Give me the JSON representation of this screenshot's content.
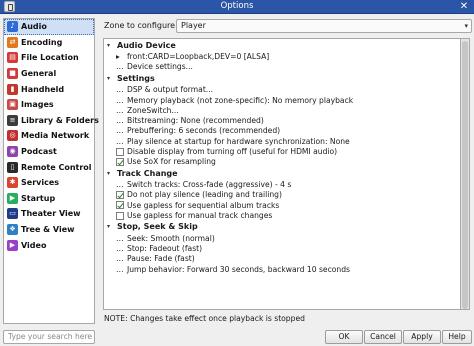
{
  "window": {
    "title": "Options",
    "close_glyph": "✕"
  },
  "sidebar": {
    "items": [
      {
        "label": "Audio",
        "icon": "audio-icon",
        "color": "#2e6bd6",
        "glyph": "♪",
        "selected": true
      },
      {
        "label": "Encoding",
        "icon": "encoding-icon",
        "color": "#e07a1f",
        "glyph": "⇄"
      },
      {
        "label": "File Location",
        "icon": "file-location-icon",
        "color": "#d43a3a",
        "glyph": "▤"
      },
      {
        "label": "General",
        "icon": "general-icon",
        "color": "#d23b3b",
        "glyph": "■"
      },
      {
        "label": "Handheld",
        "icon": "handheld-icon",
        "color": "#c0392b",
        "glyph": "▮"
      },
      {
        "label": "Images",
        "icon": "images-icon",
        "color": "#c84a4a",
        "glyph": "▣"
      },
      {
        "label": "Library & Folders",
        "icon": "library-icon",
        "color": "#3c3c3c",
        "glyph": "≡"
      },
      {
        "label": "Media Network",
        "icon": "media-network-icon",
        "color": "#c03030",
        "glyph": "◎"
      },
      {
        "label": "Podcast",
        "icon": "podcast-icon",
        "color": "#8e44ad",
        "glyph": "◉"
      },
      {
        "label": "Remote Control",
        "icon": "remote-control-icon",
        "color": "#2a2a2a",
        "glyph": "▯"
      },
      {
        "label": "Services",
        "icon": "services-icon",
        "color": "#d9452f",
        "glyph": "✱"
      },
      {
        "label": "Startup",
        "icon": "startup-icon",
        "color": "#27ae60",
        "glyph": "▶"
      },
      {
        "label": "Theater View",
        "icon": "theater-view-icon",
        "color": "#1f3c88",
        "glyph": "▭"
      },
      {
        "label": "Tree & View",
        "icon": "tree-view-icon",
        "color": "#2f80c4",
        "glyph": "❖"
      },
      {
        "label": "Video",
        "icon": "video-icon",
        "color": "#9b3fc9",
        "glyph": "▶"
      }
    ]
  },
  "zone": {
    "label": "Zone to configure:",
    "value": "Player",
    "caret": "▾"
  },
  "groups": [
    {
      "title": "Audio Device",
      "arrow": "▾",
      "rows": [
        {
          "kind": "device",
          "text": "front:CARD=Loopback,DEV=0 [ALSA]"
        },
        {
          "kind": "dots",
          "text": "Device settings..."
        }
      ]
    },
    {
      "title": "Settings",
      "arrow": "▾",
      "rows": [
        {
          "kind": "dots",
          "text": "DSP & output format..."
        },
        {
          "kind": "dots",
          "text": "Memory playback (not zone-specific): No memory playback"
        },
        {
          "kind": "dots",
          "text": "ZoneSwitch..."
        },
        {
          "kind": "dots",
          "text": "Bitstreaming: None (recommended)"
        },
        {
          "kind": "dots",
          "text": "Prebuffering: 6 seconds (recommended)"
        },
        {
          "kind": "dots",
          "text": "Play silence at startup for hardware synchronization: None"
        },
        {
          "kind": "check",
          "checked": false,
          "text": "Disable display from turning off (useful for HDMI audio)"
        },
        {
          "kind": "check",
          "checked": true,
          "text": "Use SoX for resampling"
        }
      ]
    },
    {
      "title": "Track Change",
      "arrow": "▾",
      "rows": [
        {
          "kind": "dots",
          "text": "Switch tracks: Cross-fade (aggressive) - 4 s"
        },
        {
          "kind": "check",
          "checked": true,
          "text": "Do not play silence (leading and trailing)"
        },
        {
          "kind": "check",
          "checked": true,
          "text": "Use gapless for sequential album tracks"
        },
        {
          "kind": "check",
          "checked": false,
          "text": "Use gapless for manual track changes"
        }
      ]
    },
    {
      "title": "Stop, Seek & Skip",
      "arrow": "▾",
      "rows": [
        {
          "kind": "dots",
          "text": "Seek: Smooth (normal)"
        },
        {
          "kind": "dots",
          "text": "Stop: Fadeout (fast)"
        },
        {
          "kind": "dots",
          "text": "Pause: Fade (fast)"
        },
        {
          "kind": "dots",
          "text": "Jump behavior: Forward 30 seconds, backward 10 seconds"
        }
      ]
    }
  ],
  "note": "NOTE: Changes take effect once playback is stopped",
  "search": {
    "placeholder": "Type your search here"
  },
  "buttons": {
    "ok": "OK",
    "cancel": "Cancel",
    "apply": "Apply",
    "help": "Help"
  }
}
